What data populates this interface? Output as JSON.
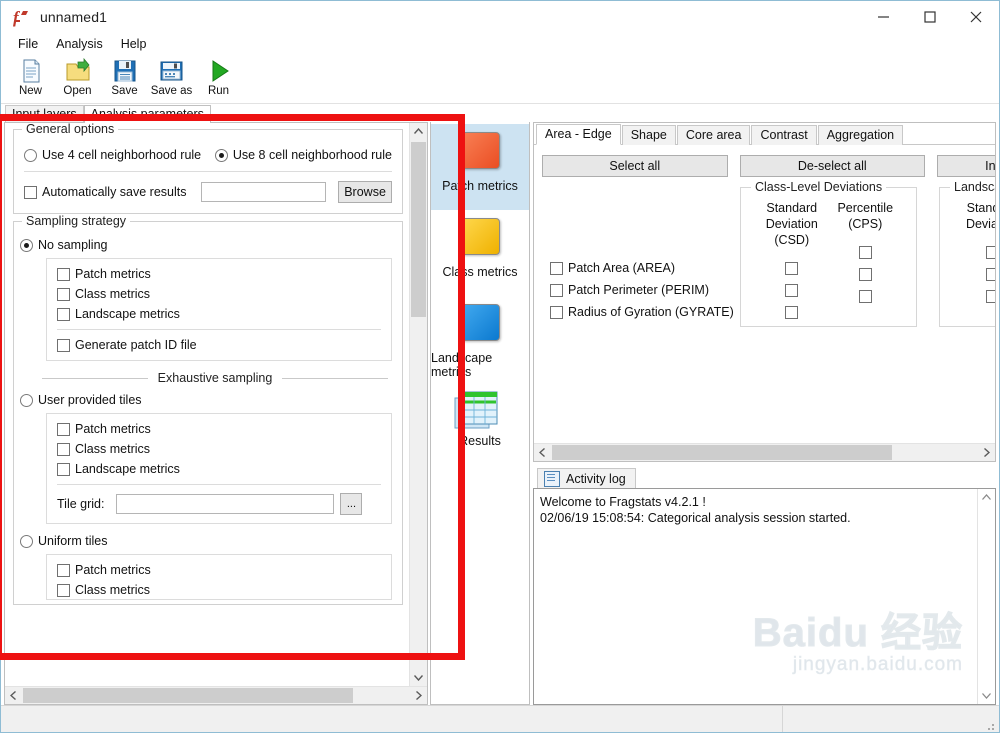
{
  "window": {
    "title": "unnamed1",
    "app_icon": "fragstats-icon",
    "controls": {
      "minimize": "minimize-icon",
      "maximize": "maximize-icon",
      "close": "close-icon"
    }
  },
  "menubar": {
    "items": [
      "File",
      "Analysis",
      "Help"
    ]
  },
  "toolbar": {
    "items": [
      {
        "label": "New",
        "icon": "new-document-icon"
      },
      {
        "label": "Open",
        "icon": "open-folder-icon"
      },
      {
        "label": "Save",
        "icon": "save-disk-icon"
      },
      {
        "label": "Save as",
        "icon": "save-as-disk-icon"
      },
      {
        "label": "Run",
        "icon": "run-play-icon"
      }
    ]
  },
  "main_tabs": [
    {
      "label": "Input layers",
      "active": false
    },
    {
      "label": "Analysis parameters",
      "active": true
    }
  ],
  "left_panel": {
    "general_options": {
      "legend": "General options",
      "rule_4": "Use 4 cell neighborhood rule",
      "rule_8": "Use 8 cell neighborhood rule",
      "rule_4_selected": false,
      "rule_8_selected": true,
      "auto_save_label": "Automatically save results",
      "auto_save_checked": false,
      "auto_save_path": "",
      "browse_label": "Browse"
    },
    "sampling_strategy": {
      "legend": "Sampling strategy",
      "no_sampling": "No sampling",
      "no_sampling_selected": true,
      "no_sampling_metrics": [
        "Patch metrics",
        "Class metrics",
        "Landscape metrics"
      ],
      "generate_patch_id": "Generate patch ID file",
      "exhaustive_divider": "Exhaustive sampling",
      "user_provided_tiles": "User provided tiles",
      "user_provided_selected": false,
      "user_provided_metrics": [
        "Patch metrics",
        "Class metrics",
        "Landscape metrics"
      ],
      "tile_grid_label": "Tile grid:",
      "tile_grid_value": "",
      "tile_grid_browse": "...",
      "uniform_tiles": "Uniform tiles",
      "uniform_tiles_selected": false,
      "uniform_tiles_metrics": [
        "Patch metrics",
        "Class metrics"
      ]
    },
    "vscroll": {
      "up": "scroll-up-icon",
      "down": "scroll-down-icon"
    },
    "hscroll": {
      "left": "scroll-left-icon",
      "right": "scroll-right-icon"
    }
  },
  "mid_panel": {
    "items": [
      {
        "label": "Patch metrics",
        "color": "#ee5a32",
        "selected": true
      },
      {
        "label": "Class metrics",
        "color": "#f4c01a",
        "selected": false
      },
      {
        "label": "Landscape metrics",
        "color": "#1e90e0",
        "selected": false
      },
      {
        "label": "Results",
        "icon": "results-table-icon",
        "selected": false
      }
    ]
  },
  "right_panel": {
    "tabs": [
      {
        "label": "Area - Edge",
        "active": true
      },
      {
        "label": "Shape",
        "active": false
      },
      {
        "label": "Core area",
        "active": false
      },
      {
        "label": "Contrast",
        "active": false
      },
      {
        "label": "Aggregation",
        "active": false
      }
    ],
    "buttons": [
      {
        "label": "Select all"
      },
      {
        "label": "De-select all"
      },
      {
        "label": "Inve"
      }
    ],
    "metrics": [
      {
        "label": "Patch Area  (AREA)",
        "checked": false
      },
      {
        "label": "Patch Perimeter  (PERIM)",
        "checked": false
      },
      {
        "label": "Radius of Gyration  (GYRATE)",
        "checked": false
      }
    ],
    "class_level": {
      "legend": "Class-Level Deviations",
      "columns": [
        {
          "line1": "Standard",
          "line2": "Deviation  (CSD)"
        },
        {
          "line1": "Percentile",
          "line2": "(CPS)"
        }
      ]
    },
    "landscape_level": {
      "legend": "Landscape-l",
      "columns": [
        {
          "line1": "Standard",
          "line2": "Deviation"
        }
      ]
    },
    "hscroll": {
      "left": "scroll-left-icon",
      "right": "scroll-right-icon"
    }
  },
  "activity_log": {
    "tab_label": "Activity log",
    "tab_icon": "log-document-icon",
    "lines": [
      "Welcome to Fragstats v4.2.1 !",
      "02/06/19 15:08:54: Categorical analysis session started."
    ],
    "vscroll": {
      "up": "scroll-up-icon",
      "down": "scroll-down-icon"
    }
  },
  "watermark": {
    "main": "Baidu 经验",
    "sub": "jingyan.baidu.com"
  },
  "annotation": {
    "type": "red-rectangle-highlight",
    "color": "#ee1111"
  }
}
